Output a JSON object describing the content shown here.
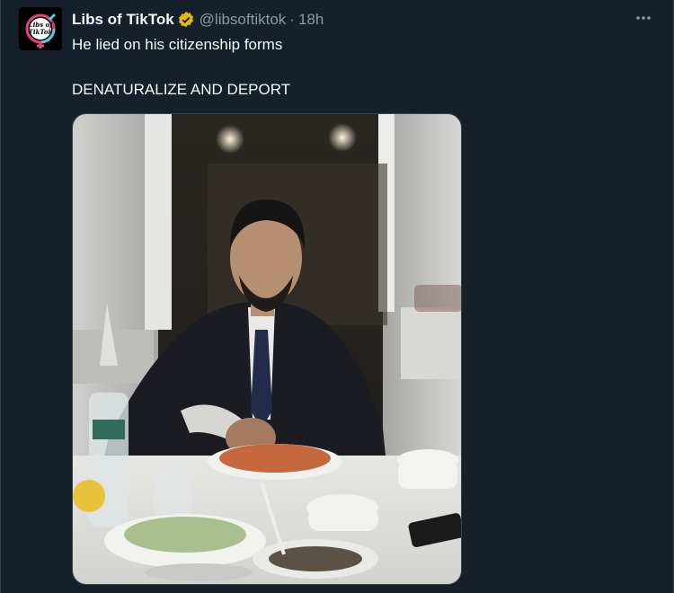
{
  "tweet": {
    "author_name": "Libs of TikTok",
    "handle": "@libsoftiktok",
    "separator": "·",
    "time": "18h",
    "more_label": "•••",
    "avatar_text": "Libs of TikTok",
    "text_line_1": "He lied on his citizenship forms",
    "text_line_2": "DENATURALIZE AND DEPORT",
    "photo_description": "Man in dark suit eating rice with his hand at a restaurant table",
    "verified_color": "#e2b719"
  },
  "theme": {
    "background": "#15202b",
    "text_primary": "#f7f9f9",
    "text_secondary": "#8b98a5",
    "border": "#38444d"
  }
}
